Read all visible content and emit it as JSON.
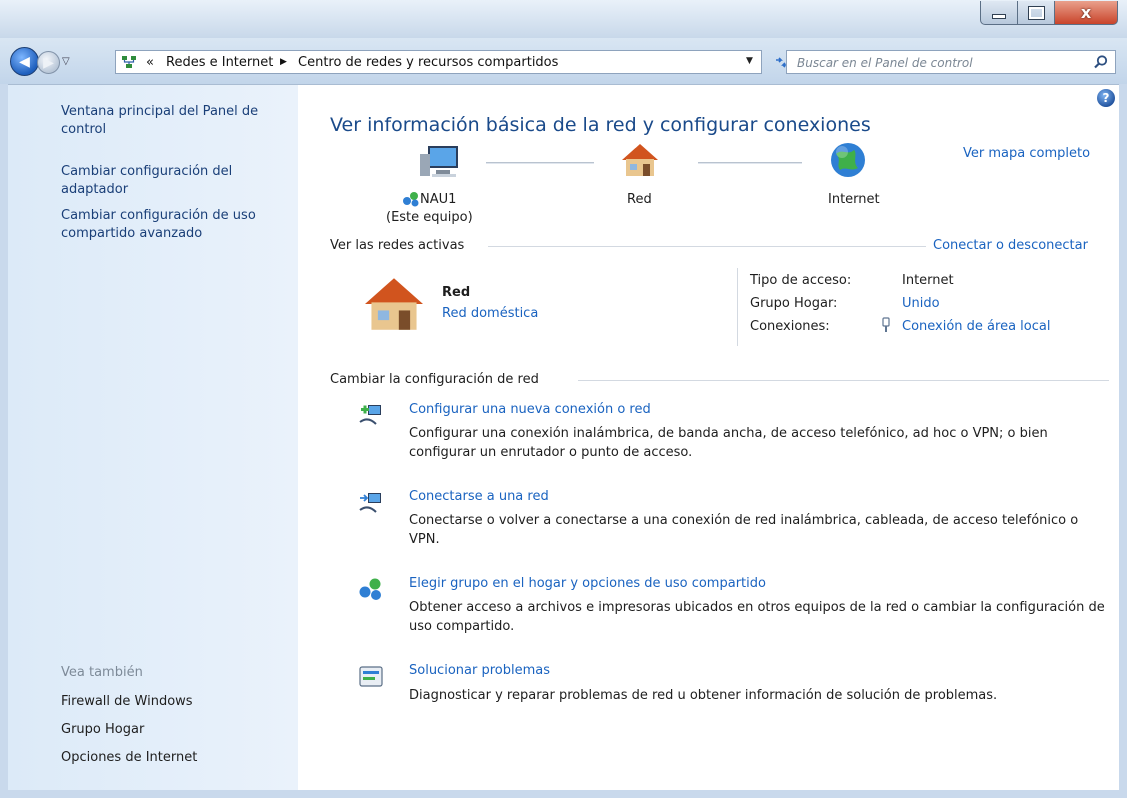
{
  "window": {
    "close_glyph": "x"
  },
  "address_bar": {
    "overflow": "«",
    "breadcrumb": [
      "Redes e Internet",
      "Centro de redes y recursos compartidos"
    ],
    "search_placeholder": "Buscar en el Panel de control"
  },
  "sidebar": {
    "links": [
      "Ventana principal del Panel de control",
      "Cambiar configuración del adaptador",
      "Cambiar configuración de uso compartido avanzado"
    ],
    "see_also_label": "Vea también",
    "see_also": [
      "Firewall de Windows",
      "Grupo Hogar",
      "Opciones de Internet"
    ]
  },
  "main": {
    "title": "Ver información básica de la red y configurar conexiones",
    "map_link": "Ver mapa completo",
    "map": {
      "computer_name": "NAU1",
      "computer_sub": "(Este equipo)",
      "network": "Red",
      "internet": "Internet"
    },
    "active_networks": {
      "heading": "Ver las redes activas",
      "connect_link": "Conectar o desconectar",
      "network_name": "Red",
      "network_type": "Red doméstica",
      "props": [
        {
          "label": "Tipo de acceso:",
          "value": "Internet"
        },
        {
          "label": "Grupo Hogar:",
          "value": "Unido"
        },
        {
          "label": "Conexiones:",
          "value": "Conexión de área local"
        }
      ]
    },
    "change_settings": {
      "heading": "Cambiar la configuración de red",
      "tasks": [
        {
          "title": "Configurar una nueva conexión o red",
          "desc": "Configurar una conexión inalámbrica, de banda ancha, de acceso telefónico, ad hoc o VPN; o bien configurar un enrutador o punto de acceso."
        },
        {
          "title": "Conectarse a una red",
          "desc": "Conectarse o volver a conectarse a una conexión de red inalámbrica, cableada, de acceso telefónico o VPN."
        },
        {
          "title": "Elegir grupo en el hogar y opciones de uso compartido",
          "desc": "Obtener acceso a archivos e impresoras ubicados en otros equipos de la red o cambiar la configuración de uso compartido."
        },
        {
          "title": "Solucionar problemas",
          "desc": "Diagnosticar y reparar problemas de red u obtener información de solución de problemas."
        }
      ]
    }
  }
}
